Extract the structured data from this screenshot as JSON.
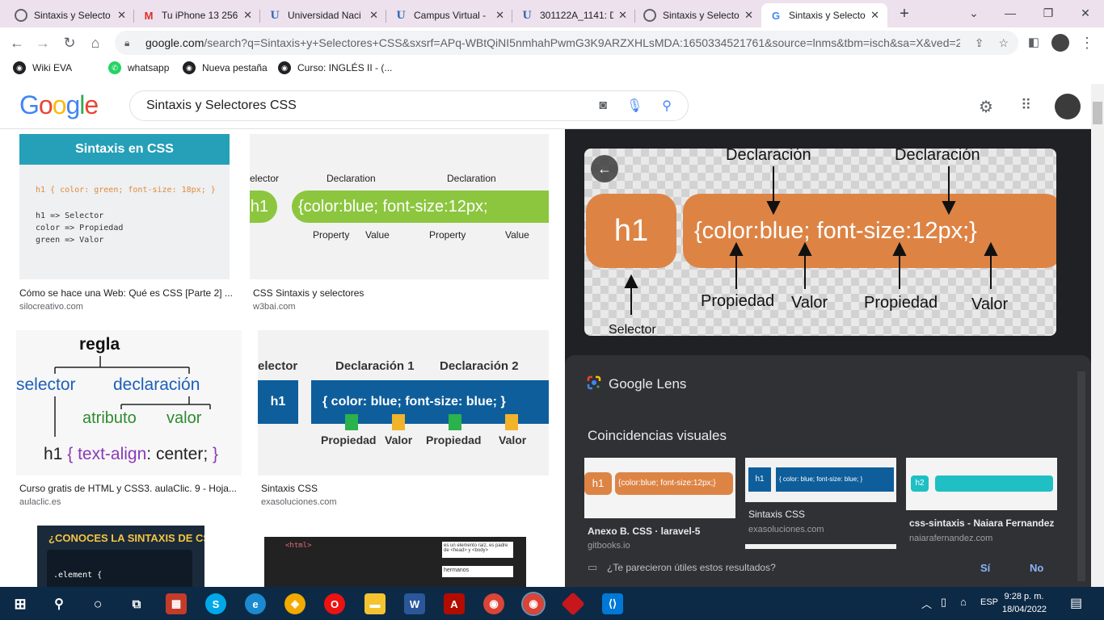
{
  "tabs": [
    {
      "title": "Sintaxis y Selecto",
      "icon": "globe-icon"
    },
    {
      "title": "Tu iPhone 13 256",
      "icon": "gmail-icon"
    },
    {
      "title": "Universidad Naci",
      "icon": "unad-icon"
    },
    {
      "title": "Campus Virtual -",
      "icon": "unad-icon"
    },
    {
      "title": "301122A_1141: D",
      "icon": "unad-icon"
    },
    {
      "title": "Sintaxis y Selecto",
      "icon": "globe-icon"
    },
    {
      "title": "Sintaxis y Selecto",
      "icon": "google-icon",
      "active": true
    }
  ],
  "address": {
    "host": "google.com",
    "path": "/search?q=Sintaxis+y+Selectores+CSS&sxsrf=APq-WBtQiNI5nmhahPwmG3K9ARZXHLsMDA:1650334521761&source=lnms&tbm=isch&sa=X&ved=2..."
  },
  "bookmarks": [
    "Wiki EVA",
    "whatsapp",
    "Nueva pestaña",
    "Curso: INGLÉS II - (..."
  ],
  "search": {
    "query": "Sintaxis y Selectores CSS",
    "logo": "Google"
  },
  "results": [
    {
      "title": "Cómo se hace una Web: Qué es CSS [Parte 2] ...",
      "source": "silocreativo.com",
      "img": {
        "heading": "Sintaxis en CSS",
        "line1": "h1 { color: green; font-size: 18px; }",
        "line2": "h1 => Selector",
        "line3": "color => Propiedad",
        "line4": "green => Valor"
      }
    },
    {
      "title": "CSS Sintaxis y selectores",
      "source": "w3bai.com",
      "img": {
        "sel": "elector",
        "decl1": "Declaration",
        "decl2": "Declaration",
        "h1": "h1",
        "code": "{color:blue; font-size:12px;",
        "p1": "Property",
        "v1": "Value",
        "p2": "Property",
        "v2": "Value"
      }
    },
    {
      "title": "Curso gratis de HTML y CSS3. aulaClic. 9 - Hoja...",
      "source": "aulaclic.es",
      "img": {
        "regla": "regla",
        "selector": "selector",
        "declaracion": "declaración",
        "atributo": "atributo",
        "valor": "valor",
        "h1": "h1",
        "code_a": "{",
        "code_b": "text-align",
        "code_c": ": center;",
        "code_d": "}"
      }
    },
    {
      "title": "Sintaxis CSS",
      "source": "exasoluciones.com",
      "img": {
        "selector": "elector",
        "d1": "Declaración 1",
        "d2": "Declaración 2",
        "h1": "h1",
        "code": "{ color: blue; font-size: blue; }",
        "p1": "Propiedad",
        "v1": "Valor",
        "p2": "Propiedad",
        "v2": "Valor"
      }
    },
    {
      "title": "",
      "source": "",
      "img": {
        "heading": "¿CONOCES LA SINTAXIS DE CSS?",
        "code": ".element {"
      }
    },
    {
      "title": "",
      "source": "",
      "img": {
        "note1": "es un elemento raíz, es padre de <head> y <body>",
        "note2": "hermanos",
        "code": "<html>"
      }
    }
  ],
  "preview": {
    "decl1": "Declaración",
    "decl2": "Declaración",
    "h1": "h1",
    "code": "{color:blue; font-size:12px;}",
    "prop1": "Propiedad",
    "val1": "Valor",
    "prop2": "Propiedad",
    "val2": "Valor",
    "selector": "Selector"
  },
  "lens": {
    "title": "Google Lens",
    "matches_heading": "Coincidencias visuales",
    "matches": [
      {
        "title": "Anexo B. CSS · laravel-5",
        "source": "gitbooks.io"
      },
      {
        "title": "Sintaxis CSS",
        "source": "exasoluciones.com"
      },
      {
        "title": "css-sintaxis - Naiara Fernandez",
        "source": "naiarafernandez.com"
      }
    ],
    "feedback_question": "¿Te parecieron útiles estos resultados?",
    "yes": "Sí",
    "no": "No"
  },
  "taskbar": {
    "lang": "ESP",
    "time": "9:28 p. m.",
    "date": "18/04/2022"
  },
  "colors": {
    "orange": "#dd8445",
    "blue": "#0e5e9c",
    "teal": "#1fbfc4",
    "green": "#8cc63f"
  }
}
